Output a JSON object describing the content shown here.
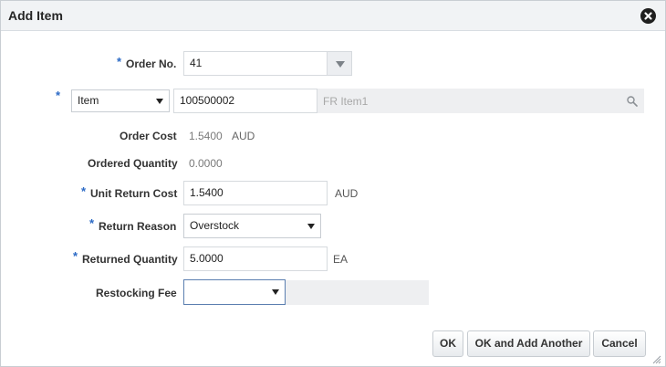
{
  "dialog": {
    "title": "Add Item",
    "close_icon": "close-circle-icon"
  },
  "required_marker": "*",
  "order_no": {
    "label": "Order No.",
    "value": "41",
    "dropdown_icon": "triangle-down-icon"
  },
  "item": {
    "type_select": "Item",
    "value": "100500002",
    "description": "FR Item1",
    "search_icon": "magnifier-icon"
  },
  "order_cost": {
    "label": "Order Cost",
    "value": "1.5400",
    "currency": "AUD"
  },
  "ordered_quantity": {
    "label": "Ordered Quantity",
    "value": "0.0000"
  },
  "unit_return_cost": {
    "label": "Unit Return Cost",
    "value": "1.5400",
    "currency": "AUD"
  },
  "return_reason": {
    "label": "Return Reason",
    "value": "Overstock"
  },
  "returned_quantity": {
    "label": "Returned Quantity",
    "value": "5.0000",
    "uom": "EA"
  },
  "restocking_fee": {
    "label": "Restocking Fee",
    "value": ""
  },
  "buttons": {
    "ok": "OK",
    "ok_add_another": "OK and Add Another",
    "cancel": "Cancel"
  },
  "colors": {
    "required_marker": "#2a69c5",
    "titlebar": "#f1f3f5",
    "disabled_field": "#eeeff1"
  }
}
